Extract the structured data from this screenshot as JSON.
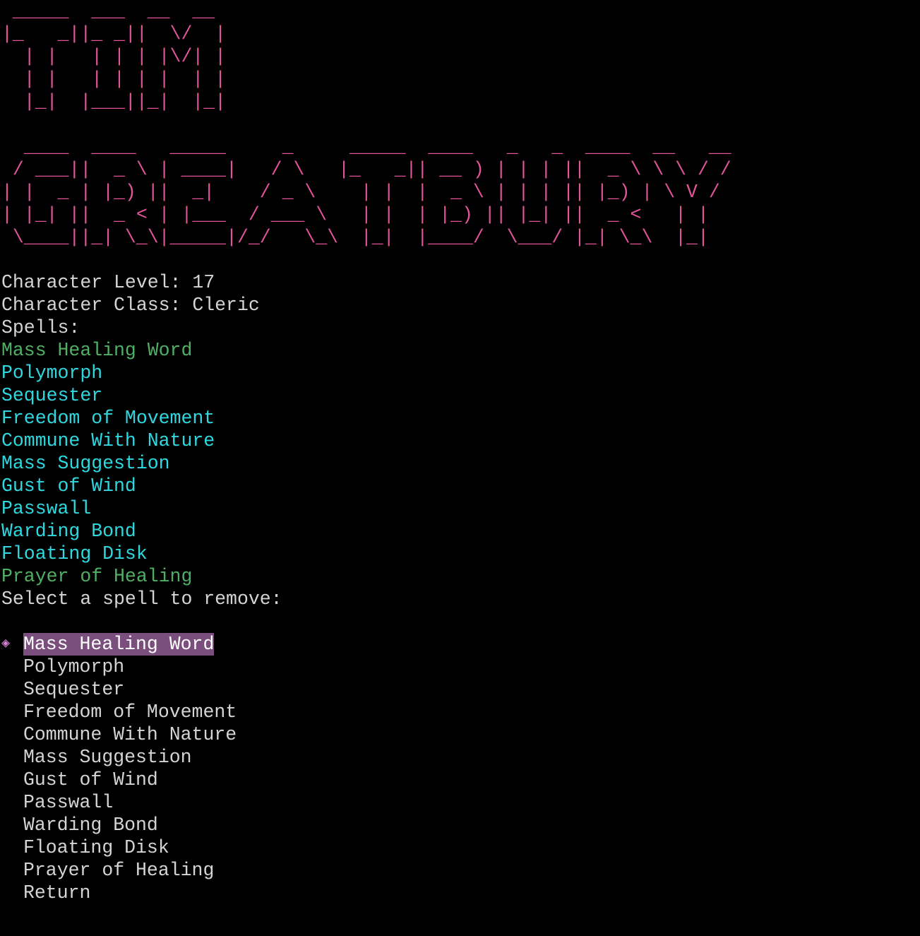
{
  "colors": {
    "background": "#000000",
    "banner": "#e0559a",
    "text": "#d4d4d4",
    "spell_prepared": "#4fb064",
    "spell_known": "#2fd8e0",
    "menu_highlight": "#7a4f7e",
    "pointer": "#d080d0"
  },
  "banner": {
    "lines": [
      " _____  ___  __  __",
      "|_   _||_ _||  \\/  |",
      "  | |   | | | |\\/| |",
      "  | |   | | | |  | |",
      "  |_|  |___||_|  |_|",
      "",
      "  ____  ____   _____     _     _____  ____   _   _  ____  __   __",
      " / ___||  _ \\ | ____|   / \\   |_   _|| __ ) | | | ||  _ \\ \\ \\ / /",
      "| |  _ | |_) ||  _|    / _ \\    | |  |  _ \\ | | | || |_) | \\ V /",
      "| |_| ||  _ < | |___  / ___ \\   | |  | |_) || |_| ||  _ <   | |",
      " \\____||_| \\_\\|_____|/_/   \\_\\  |_|  |____/  \\___/ |_| \\_\\  |_|"
    ]
  },
  "character": {
    "level_line": "Character Level: 17",
    "class_line": "Character Class: Cleric",
    "spells_header": "Spells:"
  },
  "spells": [
    {
      "name": "Mass Healing Word",
      "color": "#4fb064"
    },
    {
      "name": "Polymorph",
      "color": "#2fd8e0"
    },
    {
      "name": "Sequester",
      "color": "#2fd8e0"
    },
    {
      "name": "Freedom of Movement",
      "color": "#2fd8e0"
    },
    {
      "name": "Commune With Nature",
      "color": "#2fd8e0"
    },
    {
      "name": "Mass Suggestion",
      "color": "#2fd8e0"
    },
    {
      "name": "Gust of Wind",
      "color": "#2fd8e0"
    },
    {
      "name": "Passwall",
      "color": "#2fd8e0"
    },
    {
      "name": "Warding Bond",
      "color": "#2fd8e0"
    },
    {
      "name": "Floating Disk",
      "color": "#2fd8e0"
    },
    {
      "name": "Prayer of Healing",
      "color": "#4fb064"
    }
  ],
  "prompt": "Select a spell to remove:",
  "menu": {
    "pointer_icon": "diamond-pointer-icon",
    "pointer_glyph": "◈",
    "selected_index": 0,
    "options": [
      "Mass Healing Word",
      "Polymorph",
      "Sequester",
      "Freedom of Movement",
      "Commune With Nature",
      "Mass Suggestion",
      "Gust of Wind",
      "Passwall",
      "Warding Bond",
      "Floating Disk",
      "Prayer of Healing",
      "Return"
    ]
  }
}
